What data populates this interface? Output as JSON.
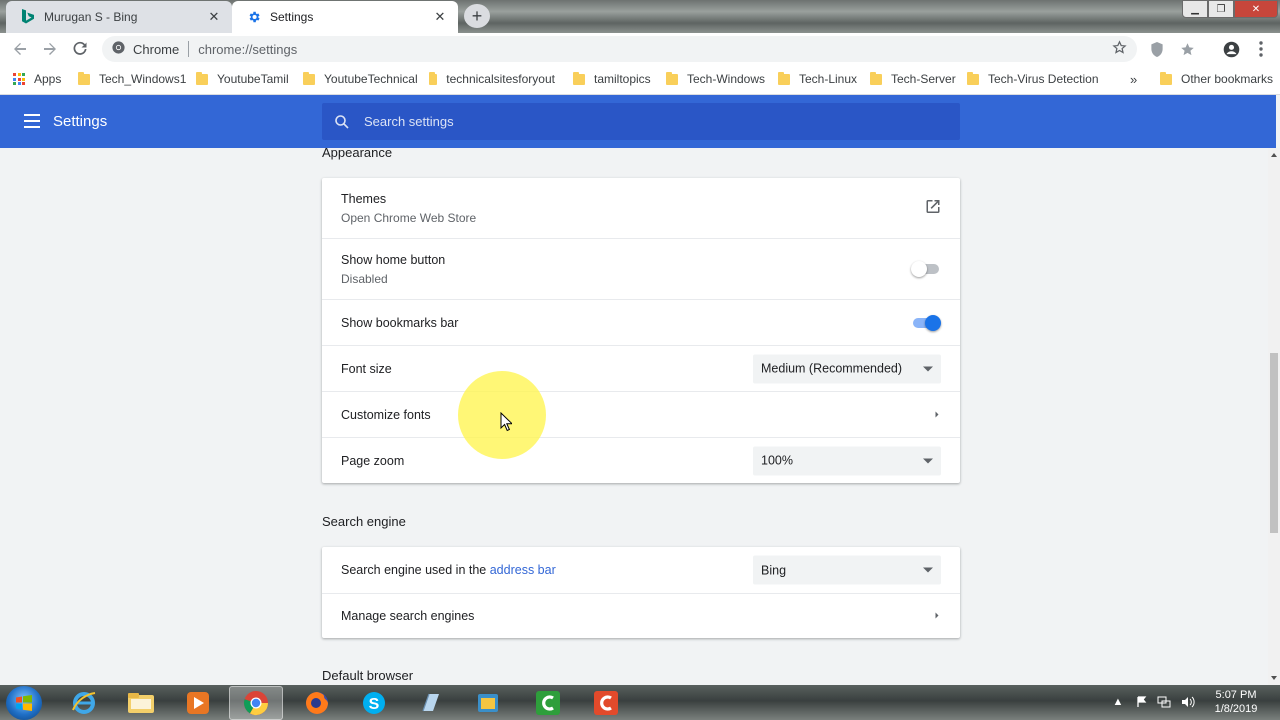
{
  "tabs": [
    {
      "title": "Murugan S - Bing",
      "icon": "bing-icon",
      "active": false
    },
    {
      "title": "Settings",
      "icon": "gear-icon",
      "active": true
    }
  ],
  "toolbar": {
    "site_label": "Chrome",
    "url": "chrome://settings"
  },
  "bookmarks": {
    "apps_label": "Apps",
    "items": [
      "Tech_Windows1",
      "YoutubeTamil",
      "YoutubeTechnical",
      "technicalsitesforyout",
      "tamiltopics",
      "Tech-Windows",
      "Tech-Linux",
      "Tech-Server",
      "Tech-Virus Detection"
    ],
    "overflow": "»",
    "other": "Other bookmarks"
  },
  "header": {
    "title": "Settings",
    "search_placeholder": "Search settings"
  },
  "appearance": {
    "title": "Appearance",
    "themes_label": "Themes",
    "themes_sub": "Open Chrome Web Store",
    "home_label": "Show home button",
    "home_sub": "Disabled",
    "home_enabled": false,
    "bookmarks_bar_label": "Show bookmarks bar",
    "bookmarks_bar_enabled": true,
    "font_size_label": "Font size",
    "font_size_value": "Medium (Recommended)",
    "customize_fonts_label": "Customize fonts",
    "page_zoom_label": "Page zoom",
    "page_zoom_value": "100%"
  },
  "search_engine": {
    "title": "Search engine",
    "used_label_prefix": "Search engine used in the ",
    "used_label_link": "address bar",
    "used_value": "Bing",
    "manage_label": "Manage search engines"
  },
  "default_browser": {
    "title": "Default browser"
  },
  "taskbar": {
    "time": "5:07 PM",
    "date": "1/8/2019"
  },
  "colors": {
    "header_blue": "#3367d6",
    "search_blue": "#2a56c6",
    "toggle_on": "#1a73e8",
    "link": "#3367d6"
  }
}
